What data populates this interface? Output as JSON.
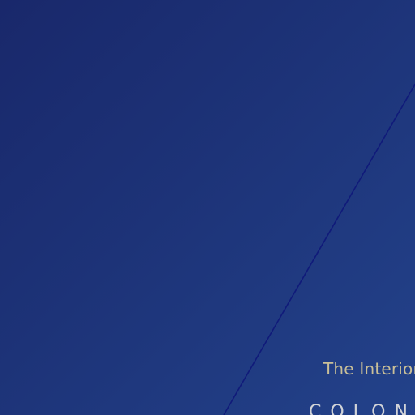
{
  "colors": {
    "background_start": "#19286b",
    "background_end": "#23428a",
    "diagonal_line": "#101a7a",
    "tagline_text": "#c9bf98",
    "brand_text": "#d2d4d8"
  },
  "tagline": {
    "text": "The Interior"
  },
  "brand": {
    "text": "COLONIE"
  }
}
